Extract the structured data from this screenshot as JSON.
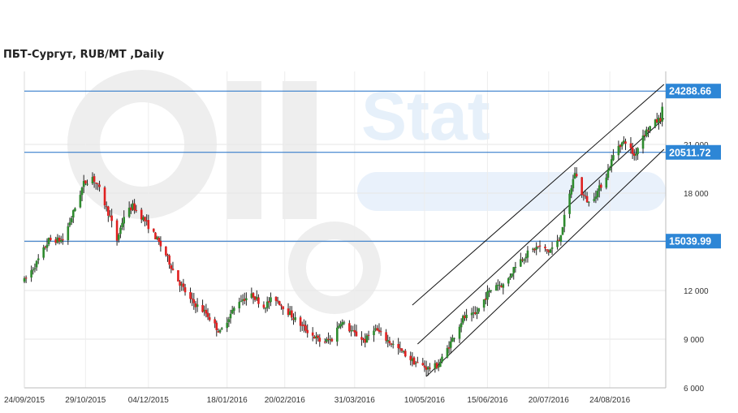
{
  "chart_data": {
    "type": "candlestick",
    "title": "ПБТ-Сургут,  RUB/MT ,Daily",
    "watermark": "Oil Stat",
    "ylim": [
      6000,
      25500
    ],
    "y_ticks": [
      6000,
      9000,
      12000,
      15000,
      18000,
      21000
    ],
    "y_tick_labels": [
      "6 000",
      "9 000",
      "12 000",
      "15 000",
      "18 000",
      "21 000"
    ],
    "x_tick_labels": [
      "24/09/2015",
      "29/10/2015",
      "04/12/2015",
      "18/01/2016",
      "20/02/2016",
      "31/03/2016",
      "10/05/2016",
      "15/06/2016",
      "20/07/2016",
      "24/08/2016"
    ],
    "x_range": [
      "2015-09-24",
      "2016-09-25"
    ],
    "grid": true,
    "levels": [
      {
        "value": 24288.66,
        "label": "24288.66"
      },
      {
        "value": 20511.72,
        "label": "20511.72"
      },
      {
        "value": 15039.99,
        "label": "15039.99"
      }
    ],
    "trend_lines": [
      {
        "start": [
          "2016-05-03",
          11100
        ],
        "end": [
          "2016-09-24",
          24700
        ]
      },
      {
        "start": [
          "2016-05-06",
          8700
        ],
        "end": [
          "2016-09-24",
          22600
        ]
      },
      {
        "start": [
          "2016-05-11",
          6700
        ],
        "end": [
          "2016-09-24",
          20700
        ]
      }
    ],
    "colors": {
      "up": "#2e8b2e",
      "down": "#e02020",
      "level_line": "#1f6fc5",
      "level_label_bg": "#2d86d6",
      "trend": "#111111"
    },
    "anchors": [
      [
        "2015-09-24",
        12600
      ],
      [
        "2015-10-01",
        13700
      ],
      [
        "2015-10-08",
        15100
      ],
      [
        "2015-10-16",
        15100
      ],
      [
        "2015-10-22",
        16800
      ],
      [
        "2015-10-28",
        18600
      ],
      [
        "2015-11-02",
        19000
      ],
      [
        "2015-11-06",
        18200
      ],
      [
        "2015-11-12",
        16500
      ],
      [
        "2015-11-16",
        15100
      ],
      [
        "2015-11-20",
        16600
      ],
      [
        "2015-11-25",
        17200
      ],
      [
        "2015-12-02",
        16300
      ],
      [
        "2015-12-08",
        15300
      ],
      [
        "2015-12-14",
        14200
      ],
      [
        "2015-12-20",
        12800
      ],
      [
        "2015-12-28",
        11400
      ],
      [
        "2016-01-06",
        10600
      ],
      [
        "2016-01-14",
        9400
      ],
      [
        "2016-01-18",
        10200
      ],
      [
        "2016-01-25",
        11400
      ],
      [
        "2016-02-02",
        11700
      ],
      [
        "2016-02-08",
        11000
      ],
      [
        "2016-02-14",
        11600
      ],
      [
        "2016-02-20",
        10900
      ],
      [
        "2016-02-27",
        10100
      ],
      [
        "2016-03-05",
        9400
      ],
      [
        "2016-03-12",
        8800
      ],
      [
        "2016-03-18",
        9000
      ],
      [
        "2016-03-23",
        10100
      ],
      [
        "2016-03-30",
        9400
      ],
      [
        "2016-04-06",
        8900
      ],
      [
        "2016-04-11",
        9700
      ],
      [
        "2016-04-18",
        9000
      ],
      [
        "2016-04-25",
        8400
      ],
      [
        "2016-05-04",
        7600
      ],
      [
        "2016-05-12",
        7200
      ],
      [
        "2016-05-18",
        7400
      ],
      [
        "2016-05-25",
        8800
      ],
      [
        "2016-06-01",
        10300
      ],
      [
        "2016-06-08",
        10500
      ],
      [
        "2016-06-15",
        11800
      ],
      [
        "2016-06-20",
        12400
      ],
      [
        "2016-06-25",
        12300
      ],
      [
        "2016-07-01",
        13600
      ],
      [
        "2016-07-08",
        14300
      ],
      [
        "2016-07-14",
        14700
      ],
      [
        "2016-07-20",
        14400
      ],
      [
        "2016-07-26",
        15100
      ],
      [
        "2016-07-31",
        17400
      ],
      [
        "2016-08-04",
        19300
      ],
      [
        "2016-08-08",
        18000
      ],
      [
        "2016-08-12",
        17400
      ],
      [
        "2016-08-17",
        18100
      ],
      [
        "2016-08-22",
        19100
      ],
      [
        "2016-08-28",
        20900
      ],
      [
        "2016-09-02",
        21200
      ],
      [
        "2016-09-07",
        20300
      ],
      [
        "2016-09-12",
        21600
      ],
      [
        "2016-09-17",
        22200
      ],
      [
        "2016-09-22",
        22600
      ],
      [
        "2016-09-25",
        24300
      ]
    ]
  }
}
